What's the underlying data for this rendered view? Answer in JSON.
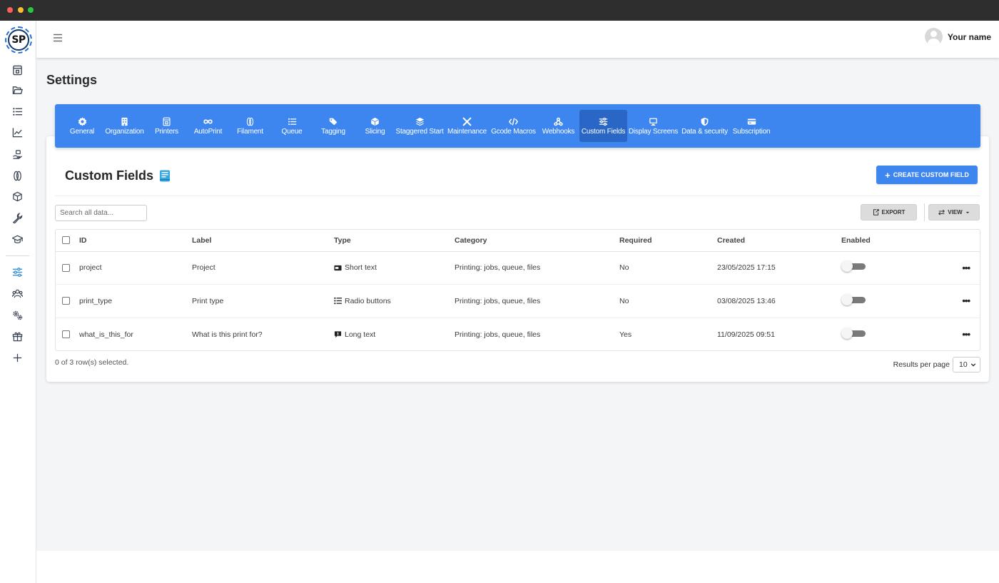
{
  "app": {
    "logo_text": "SP"
  },
  "user": {
    "name": "Your name"
  },
  "page": {
    "title": "Settings"
  },
  "sidebar": {
    "items": [
      {
        "name": "dashboard-icon"
      },
      {
        "name": "folder-icon"
      },
      {
        "name": "list-icon"
      },
      {
        "name": "chart-line-icon"
      },
      {
        "name": "print-hand-icon"
      },
      {
        "name": "filament-icon"
      },
      {
        "name": "cube-icon"
      },
      {
        "name": "wrench-icon"
      },
      {
        "name": "graduation-cap-icon"
      },
      {
        "name": "sliders-icon"
      },
      {
        "name": "users-icon"
      },
      {
        "name": "gears-icon"
      },
      {
        "name": "gift-icon"
      },
      {
        "name": "plus-icon"
      }
    ]
  },
  "tabs": [
    {
      "label": "General",
      "icon": "gear-icon"
    },
    {
      "label": "Organization",
      "icon": "building-icon"
    },
    {
      "label": "Printers",
      "icon": "printer-icon"
    },
    {
      "label": "AutoPrint",
      "icon": "infinity-icon"
    },
    {
      "label": "Filament",
      "icon": "filament-icon"
    },
    {
      "label": "Queue",
      "icon": "list-icon"
    },
    {
      "label": "Tagging",
      "icon": "tags-icon"
    },
    {
      "label": "Slicing",
      "icon": "cube-icon"
    },
    {
      "label": "Staggered Start",
      "icon": "layers-icon"
    },
    {
      "label": "Maintenance",
      "icon": "tools-icon"
    },
    {
      "label": "Gcode Macros",
      "icon": "code-icon"
    },
    {
      "label": "Webhooks",
      "icon": "webhook-icon"
    },
    {
      "label": "Custom Fields",
      "icon": "sliders-icon",
      "active": true
    },
    {
      "label": "Display Screens",
      "icon": "monitor-icon"
    },
    {
      "label": "Data & security",
      "icon": "shield-icon"
    },
    {
      "label": "Subscription",
      "icon": "credit-card-icon"
    }
  ],
  "custom_fields": {
    "title": "Custom Fields",
    "create_label": "CREATE CUSTOM FIELD",
    "search_placeholder": "Search all data...",
    "export_label": "EXPORT",
    "view_label": "VIEW",
    "columns": [
      "ID",
      "Label",
      "Type",
      "Category",
      "Required",
      "Created",
      "Enabled"
    ],
    "rows": [
      {
        "id": "project",
        "label": "Project",
        "type": "Short text",
        "type_icon": "textbox-icon",
        "category": "Printing: jobs, queue, files",
        "required": "No",
        "created": "23/05/2025 17:15",
        "enabled": false
      },
      {
        "id": "print_type",
        "label": "Print type",
        "type": "Radio buttons",
        "type_icon": "radio-list-icon",
        "category": "Printing: jobs, queue, files",
        "required": "No",
        "created": "03/08/2025 13:46",
        "enabled": false
      },
      {
        "id": "what_is_this_for",
        "label": "What is this print for?",
        "type": "Long text",
        "type_icon": "comment-icon",
        "category": "Printing: jobs, queue, files",
        "required": "Yes",
        "created": "11/09/2025 09:51",
        "enabled": false
      }
    ],
    "selection_text": "0 of 3 row(s) selected.",
    "results_per_page_label": "Results per page",
    "results_per_page_value": "10"
  },
  "colors": {
    "accent": "#3d86f0",
    "active_tab": "#2a66c6",
    "titlebar": "#2e2e2e"
  }
}
